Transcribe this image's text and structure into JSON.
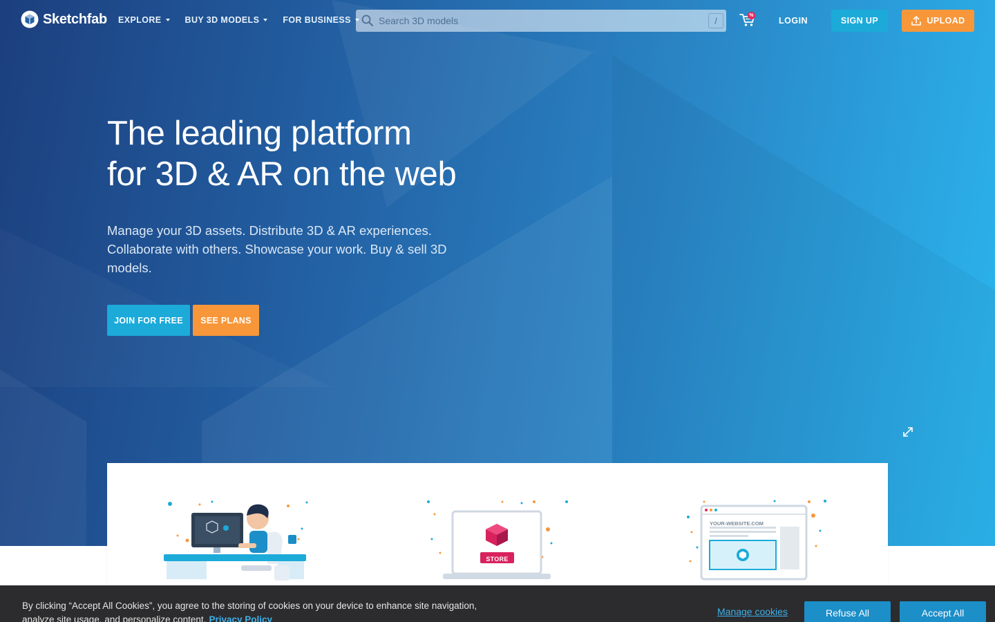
{
  "brand": {
    "name": "Sketchfab",
    "logo_icon": "sketchfab-cube-icon"
  },
  "nav": {
    "items": [
      {
        "label": "EXPLORE"
      },
      {
        "label": "BUY 3D MODELS"
      },
      {
        "label": "FOR BUSINESS"
      }
    ],
    "search_placeholder": "Search 3D models",
    "search_shortcut": "/",
    "cart_badge": "%",
    "login_label": "LOGIN",
    "signup_label": "SIGN UP",
    "upload_label": "UPLOAD"
  },
  "hero": {
    "headline_line1": "The leading platform",
    "headline_line2": "for 3D & AR on the web",
    "subtext": "Manage your 3D assets. Distribute 3D & AR experiences. Collaborate with others. Showcase your work. Buy & sell 3D models.",
    "join_label": "JOIN FOR FREE",
    "plans_label": "SEE PLANS"
  },
  "features": {
    "store_label": "STORE",
    "website_label": "YOUR-WEBSITE.COM"
  },
  "cookie": {
    "text": "By clicking “Accept All Cookies”, you agree to the storing of cookies on your device to enhance site navigation, analyze site usage, and personalize content.",
    "privacy_label": "Privacy Policy",
    "manage_label": "Manage cookies",
    "refuse_label": "Refuse All",
    "accept_label": "Accept All"
  },
  "colors": {
    "accent_blue": "#1caad9",
    "accent_orange": "#f7973a",
    "cookie_bg": "#2c2c2e",
    "cookie_button": "#1c8ec8",
    "badge_pink": "#e8265a"
  }
}
